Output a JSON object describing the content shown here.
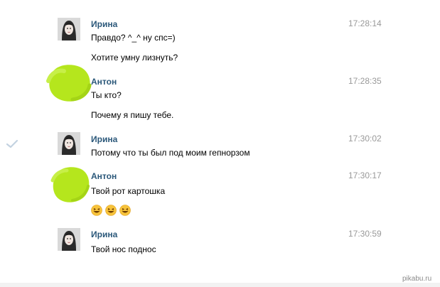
{
  "messages": [
    {
      "author": "Ирина",
      "time": "17:28:14",
      "lines": [
        "Правдо? ^_^ ну спс=)",
        "Хотите умну лизнуть?"
      ]
    },
    {
      "author": "Антон",
      "time": "17:28:35",
      "lines": [
        "Ты кто?",
        "Почему я пишу тебе."
      ]
    },
    {
      "author": "Ирина",
      "time": "17:30:02",
      "lines": [
        "Потому что ты был под моим гепнорзом"
      ]
    },
    {
      "author": "Антон",
      "time": "17:30:17",
      "lines": [
        "Твой рот картошка"
      ],
      "emoji": [
        "laughing-emoji",
        "laughing-emoji",
        "laughing-emoji"
      ]
    },
    {
      "author": "Ирина",
      "time": "17:30:59",
      "lines": [
        "Твой нос поднос"
      ]
    }
  ],
  "icons": {
    "read_check": "checkmark-icon",
    "avatar_female": "avatar-photo",
    "avatar_scribble": "green-scribble"
  },
  "colors": {
    "name": "#2b587a",
    "time": "#999999",
    "scribble": "#b5e61d",
    "emoji": "#f7c33b"
  },
  "watermark": "pikabu.ru"
}
